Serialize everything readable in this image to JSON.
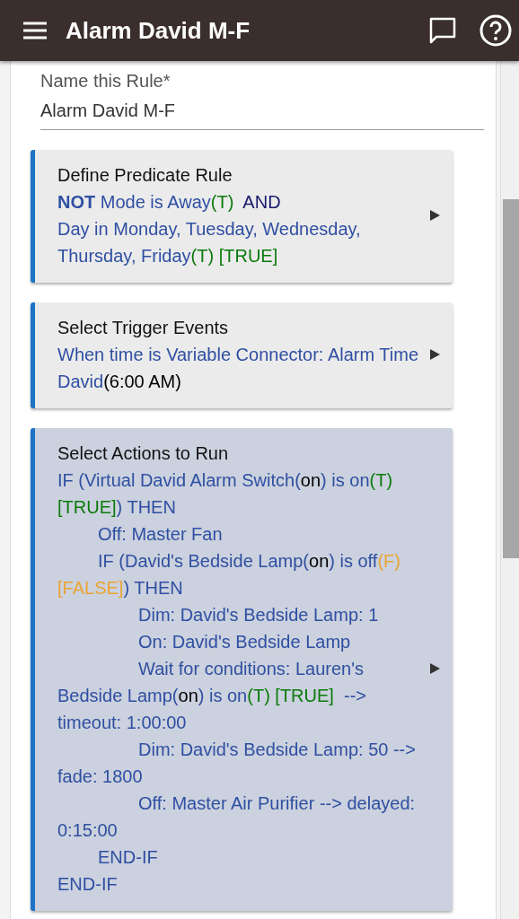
{
  "app_bar": {
    "title": "Alarm David M-F"
  },
  "name_field": {
    "label": "Name this Rule*",
    "value": "Alarm David M-F"
  },
  "sections": [
    {
      "title": "Define Predicate Rule",
      "statements": [
        {
          "segments": [
            {
              "kind": "bold",
              "text": "NOT"
            },
            {
              "kind": "text",
              "text": " Mode is Away"
            },
            {
              "kind": "true",
              "text": "(T)"
            },
            {
              "kind": "operator",
              "text": "  AND"
            }
          ]
        },
        {
          "segments": [
            {
              "kind": "text",
              "text": "Day in Monday, Tuesday, Wednesday, Thursday, Friday"
            },
            {
              "kind": "true",
              "text": "(T) [TRUE]"
            }
          ]
        }
      ]
    },
    {
      "title": "Select Trigger Events",
      "statements": [
        {
          "segments": [
            {
              "kind": "text",
              "text": "When time is Variable Connector: Alarm Time David"
            },
            {
              "kind": "value",
              "text": "(6:00 AM)"
            }
          ]
        }
      ]
    },
    {
      "title": "Select Actions to Run",
      "highlighted": true,
      "statements": [
        {
          "segments": [
            {
              "kind": "text",
              "text": "IF (Virtual David Alarm Switch("
            },
            {
              "kind": "value",
              "text": "on"
            },
            {
              "kind": "text",
              "text": ") is on"
            },
            {
              "kind": "true",
              "text": "(T) [TRUE]"
            },
            {
              "kind": "text",
              "text": ") THEN"
            }
          ],
          "children": [
            {
              "segments": [
                {
                  "kind": "text",
                  "text": "Off: Master Fan"
                }
              ]
            },
            {
              "segments": [
                {
                  "kind": "text",
                  "text": "IF (David's Bedside Lamp("
                },
                {
                  "kind": "value",
                  "text": "on"
                },
                {
                  "kind": "text",
                  "text": ") is off"
                },
                {
                  "kind": "false",
                  "text": "(F) [FALSE]"
                },
                {
                  "kind": "text",
                  "text": ") THEN"
                }
              ],
              "children": [
                {
                  "segments": [
                    {
                      "kind": "text",
                      "text": "Dim: David's Bedside Lamp: 1"
                    }
                  ]
                },
                {
                  "segments": [
                    {
                      "kind": "text",
                      "text": "On: David's Bedside Lamp"
                    }
                  ]
                },
                {
                  "segments": [
                    {
                      "kind": "text",
                      "text": "Wait for conditions: Lauren's Bedside Lamp("
                    },
                    {
                      "kind": "value",
                      "text": "on"
                    },
                    {
                      "kind": "text",
                      "text": ") is on"
                    },
                    {
                      "kind": "true",
                      "text": "(T) [TRUE]"
                    },
                    {
                      "kind": "text",
                      "text": "  --> timeout: 1:00:00"
                    }
                  ]
                },
                {
                  "segments": [
                    {
                      "kind": "text",
                      "text": "Dim: David's Bedside Lamp: 50 --> fade: 1800"
                    }
                  ]
                },
                {
                  "segments": [
                    {
                      "kind": "text",
                      "text": "Off: Master Air Purifier --> delayed: 0:15:00"
                    }
                  ]
                }
              ]
            },
            {
              "segments": [
                {
                  "kind": "text",
                  "text": "END-IF"
                }
              ]
            }
          ]
        },
        {
          "segments": [
            {
              "kind": "text",
              "text": "END-IF"
            }
          ]
        }
      ]
    }
  ]
}
